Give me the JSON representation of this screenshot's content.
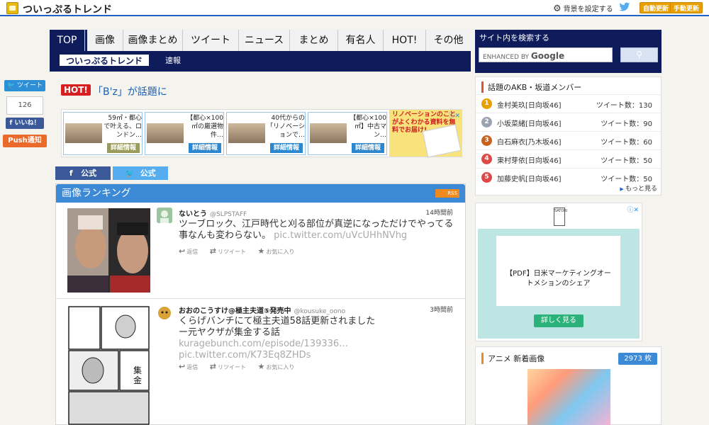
{
  "topbar": {
    "site_name": "ついっぷるトレンド",
    "bg_setting": "背景を設定する",
    "auto_update": "自動更新",
    "manual_update": "手動更新"
  },
  "nav": {
    "tabs": [
      {
        "label": "TOP",
        "active": true
      },
      {
        "label": "画像"
      },
      {
        "label": "画像まとめ"
      },
      {
        "label": "ツイート"
      },
      {
        "label": "ニュース"
      },
      {
        "label": "まとめ"
      },
      {
        "label": "有名人"
      },
      {
        "label": "HOT!"
      },
      {
        "label": "その他"
      }
    ],
    "sub_trend": "ついっぷるトレンド",
    "sub_flash": "速報"
  },
  "social": {
    "tweet": "ツイート",
    "like_count": "126",
    "like": "いいね！",
    "push": "Push通知"
  },
  "hot": {
    "badge": "HOT!",
    "text": "「B'z」が話題に"
  },
  "ads": {
    "cards": [
      {
        "text": "59㎡・都心で叶える、ロンドン…",
        "button": "詳細情報"
      },
      {
        "text": "【都心×100㎡の厳選物件…",
        "button": "詳細情報"
      },
      {
        "text": "40代からの「リノベーションで…",
        "button": "詳細情報"
      },
      {
        "text": "【都心×100㎡】中古マン…",
        "button": "詳細情報"
      }
    ],
    "renov_text": "リノベーションのことがよくわかる資料を無料でお届け!"
  },
  "official": {
    "facebook": "公式",
    "twitter": "公式"
  },
  "ranking": {
    "title": "画像ランキング",
    "rss": "RSS",
    "tweets": [
      {
        "user": "ないとう",
        "handle": "@SLPSTAFF",
        "time": "14時間前",
        "body": "ツーブロック、江戸時代と刈る部位が真逆になっただけでやってる事なんも変わらない。",
        "link": "pic.twitter.com/uVcUHhNVhg",
        "reply": "返信",
        "retweet": "リツイート",
        "fav": "お気に入り"
      },
      {
        "user": "おおのこうすけ@極主夫道⑤発売中",
        "handle": "@kousuke_oono",
        "time": "3時間前",
        "body": "くらげバンチにて極主夫道58話更新されましたー元ヤクザが集金する話",
        "link1": "kuragebunch.com/episode/139336…",
        "link2": "pic.twitter.com/K73Eq8ZHDs",
        "reply": "返信",
        "retweet": "リツイート",
        "fav": "お気に入り"
      }
    ]
  },
  "search": {
    "title": "サイト内を検索する",
    "placeholder_prefix": "ENHANCED BY",
    "placeholder_brand": "Google"
  },
  "members": {
    "title": "話題のAKB・坂道メンバー",
    "rows": [
      {
        "rank": "1",
        "name": "金村美玖[日向坂46]",
        "count": "ツイート数：130",
        "color": "#e8a000"
      },
      {
        "rank": "2",
        "name": "小坂菜緒[日向坂46]",
        "count": "ツイート数：90",
        "color": "#9aa4b0"
      },
      {
        "rank": "3",
        "name": "白石麻衣[乃木坂46]",
        "count": "ツイート数：60",
        "color": "#c8621c"
      },
      {
        "rank": "4",
        "name": "東村芽依[日向坂46]",
        "count": "ツイート数：50",
        "color": "#e04848"
      },
      {
        "rank": "5",
        "name": "加藤史帆[日向坂46]",
        "count": "ツイート数：50",
        "color": "#e04848"
      }
    ],
    "more": "もっと見る"
  },
  "ad_side": {
    "logo": "SATORI",
    "headline": "【PDF】日米マーケティングオートメションのシェア",
    "button": "詳しく見る"
  },
  "anime": {
    "title": "アニメ 新着画像",
    "count": "2973 枚"
  }
}
